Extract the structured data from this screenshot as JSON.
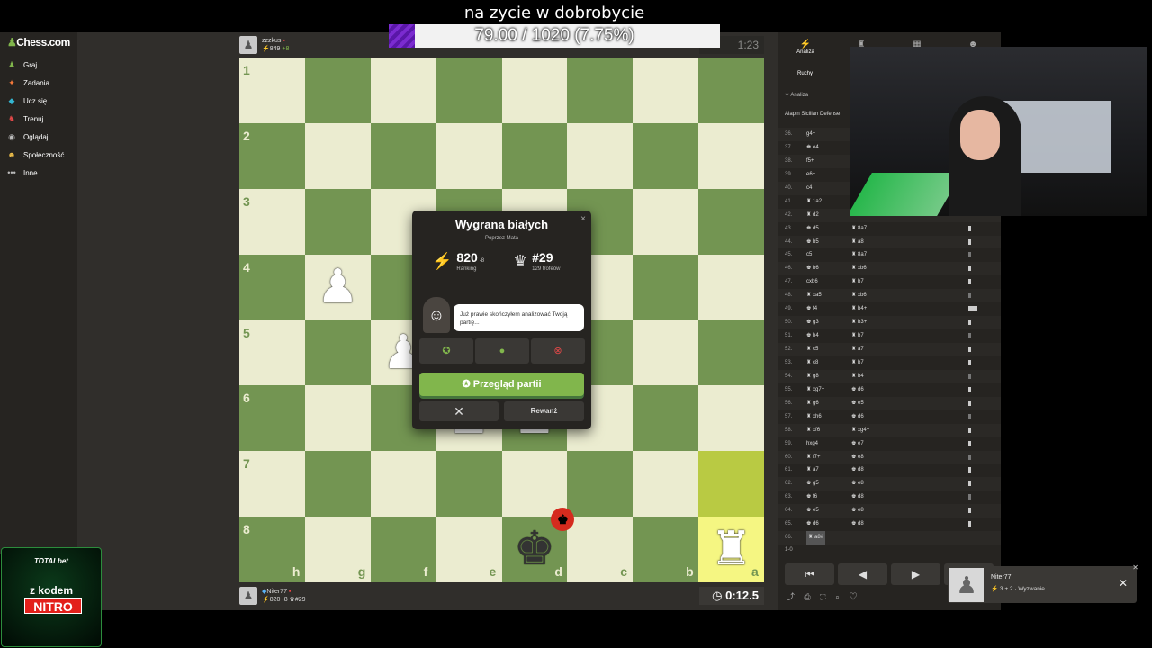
{
  "overlay": {
    "title": "na zycie w dobrobycie",
    "progress_text": "79.00 / 1020 (7.75%)",
    "progress_fraction": 0.0775
  },
  "sidebar": {
    "logo": "Chess.com",
    "items": [
      {
        "icon": "♟",
        "label": "Graj",
        "color": "#81b64c"
      },
      {
        "icon": "✦",
        "label": "Zadania",
        "color": "#f5793a"
      },
      {
        "icon": "◆",
        "label": "Ucz się",
        "color": "#34b6d2"
      },
      {
        "icon": "♞",
        "label": "Trenuj",
        "color": "#e04848"
      },
      {
        "icon": "◉",
        "label": "Oglądaj",
        "color": "#bbb"
      },
      {
        "icon": "☻",
        "label": "Społeczność",
        "color": "#eebf4a"
      },
      {
        "icon": "•••",
        "label": "Inne",
        "color": "#bbb"
      }
    ]
  },
  "top_player": {
    "name": "zzzkus",
    "rating": "849",
    "delta": "+8",
    "clock": "1:23"
  },
  "bottom_player": {
    "name": "Niter77",
    "rating": "820",
    "delta": "-8",
    "trophies": "#29",
    "clock": "0:12.5"
  },
  "board": {
    "ranks": [
      "1",
      "2",
      "3",
      "4",
      "5",
      "6",
      "7",
      "8"
    ],
    "files": [
      "h",
      "g",
      "f",
      "e",
      "d",
      "c",
      "b",
      "a"
    ]
  },
  "modal": {
    "title": "Wygrana białych",
    "subtitle": "Poprzez Mata",
    "rating_value": "820",
    "rating_delta": "-8",
    "rating_label": "Ranking",
    "trophy_value": "#29",
    "trophy_label": "129 trofeów",
    "coach_text": "Już prawie skończyłem analizować Twoją partię...",
    "review_button": "Przegląd partii",
    "rematch_button": "Rewanż",
    "close_glyph": "✕",
    "close_x": "×"
  },
  "right_panel": {
    "tabs": [
      {
        "icon": "⚡",
        "label": "Analiza"
      },
      {
        "icon": "♜",
        "label": ""
      },
      {
        "icon": "▦",
        "label": ""
      },
      {
        "icon": "☻",
        "label": ""
      }
    ],
    "subtab": "Ruchy",
    "analysis_label": "Analiza",
    "opening": "Alapin Sicilian Defense",
    "moves": [
      {
        "n": "36.",
        "w": "g4+",
        "b": ""
      },
      {
        "n": "37.",
        "w": "♚ e4",
        "b": ""
      },
      {
        "n": "38.",
        "w": "f5+",
        "b": ""
      },
      {
        "n": "39.",
        "w": "e6+",
        "b": ""
      },
      {
        "n": "40.",
        "w": "c4",
        "b": ""
      },
      {
        "n": "41.",
        "w": "♜ 1a2",
        "b": ""
      },
      {
        "n": "42.",
        "w": "♜ d2",
        "b": ""
      },
      {
        "n": "43.",
        "w": "♚ d5",
        "b": "♜ 8a7"
      },
      {
        "n": "44.",
        "w": "♚ b5",
        "b": "♜ a8"
      },
      {
        "n": "45.",
        "w": "c5",
        "b": "♜ 8a7"
      },
      {
        "n": "46.",
        "w": "♚ b6",
        "b": "♜ xb6"
      },
      {
        "n": "47.",
        "w": "cxb6",
        "b": "♜ b7"
      },
      {
        "n": "48.",
        "w": "♜ xa5",
        "b": "♜ xb6"
      },
      {
        "n": "49.",
        "w": "♚ f4",
        "b": "♜ b4+"
      },
      {
        "n": "50.",
        "w": "♚ g3",
        "b": "♜ b3+"
      },
      {
        "n": "51.",
        "w": "♚ h4",
        "b": "♜ b7"
      },
      {
        "n": "52.",
        "w": "♜ c5",
        "b": "♜ a7"
      },
      {
        "n": "53.",
        "w": "♜ c8",
        "b": "♜ b7"
      },
      {
        "n": "54.",
        "w": "♜ g8",
        "b": "♜ b4"
      },
      {
        "n": "55.",
        "w": "♜ xg7+",
        "b": "♚ d6"
      },
      {
        "n": "56.",
        "w": "♜ g6",
        "b": "♚ e5"
      },
      {
        "n": "57.",
        "w": "♜ xh6",
        "b": "♚ d6"
      },
      {
        "n": "58.",
        "w": "♜ xf6",
        "b": "♜ xg4+"
      },
      {
        "n": "59.",
        "w": "hxg4",
        "b": "♚ e7"
      },
      {
        "n": "60.",
        "w": "♜ f7+",
        "b": "♚ e8"
      },
      {
        "n": "61.",
        "w": "♜ a7",
        "b": "♚ d8"
      },
      {
        "n": "62.",
        "w": "♚ g5",
        "b": "♚ e8"
      },
      {
        "n": "63.",
        "w": "♚ f6",
        "b": "♚ d8"
      },
      {
        "n": "64.",
        "w": "♚ e5",
        "b": "♚ e8"
      },
      {
        "n": "65.",
        "w": "♚ d6",
        "b": "♚ d8"
      },
      {
        "n": "66.",
        "w": "♜ a8#",
        "b": ""
      }
    ],
    "result": "1-0",
    "controls": [
      "⏮",
      "◀",
      "▶",
      "⏭"
    ],
    "tools": "⤴ ⎙ ⛶ ⌕ ♡"
  },
  "notification": {
    "name": "Niter77",
    "sub": "3 + 2 · Wyzwanie"
  },
  "ad": {
    "brand": "TOTALbet",
    "line1": "z kodem",
    "code": "NITRO"
  }
}
